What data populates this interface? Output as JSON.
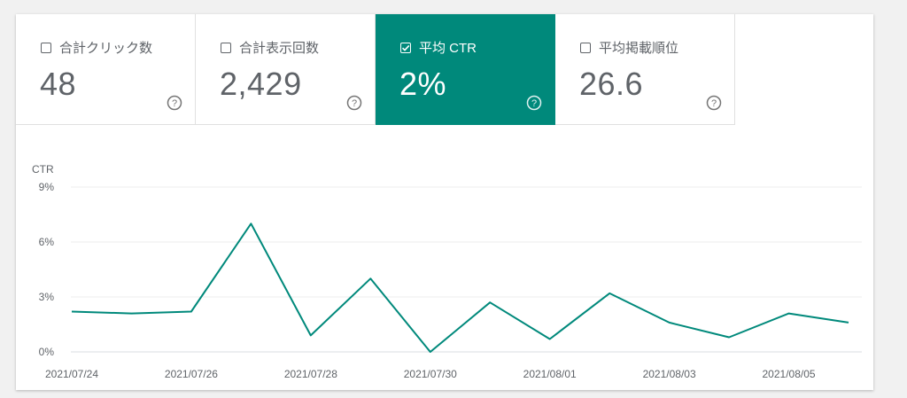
{
  "metrics": [
    {
      "label": "合計クリック数",
      "value": "48",
      "checked": false,
      "icon": "help-icon"
    },
    {
      "label": "合計表示回数",
      "value": "2,429",
      "checked": false,
      "icon": "help-icon"
    },
    {
      "label": "平均 CTR",
      "value": "2%",
      "checked": true,
      "icon": "help-icon"
    },
    {
      "label": "平均掲載順位",
      "value": "26.6",
      "checked": false,
      "icon": "help-icon"
    }
  ],
  "colors": {
    "accent": "#00897b",
    "line": "#00897b",
    "grid": "#eeeeee",
    "text": "#5f6368"
  },
  "chart_data": {
    "type": "line",
    "ylabel": "CTR",
    "ylim": [
      0,
      9
    ],
    "yticks": [
      "0%",
      "3%",
      "6%",
      "9%"
    ],
    "yticks_values": [
      0,
      3,
      6,
      9
    ],
    "x": [
      "2021/07/24",
      "2021/07/25",
      "2021/07/26",
      "2021/07/27",
      "2021/07/28",
      "2021/07/29",
      "2021/07/30",
      "2021/07/31",
      "2021/08/01",
      "2021/08/02",
      "2021/08/03",
      "2021/08/04",
      "2021/08/05",
      "2021/08/06"
    ],
    "xtick_labels": [
      "2021/07/24",
      "2021/07/26",
      "2021/07/28",
      "2021/07/30",
      "2021/08/01",
      "2021/08/03",
      "2021/08/05"
    ],
    "series": [
      {
        "values": [
          2.2,
          2.1,
          2.2,
          7.0,
          0.9,
          4.0,
          0.0,
          2.7,
          0.7,
          3.2,
          1.6,
          0.8,
          2.1,
          1.6
        ]
      }
    ],
    "grid": true,
    "legend": "none"
  }
}
